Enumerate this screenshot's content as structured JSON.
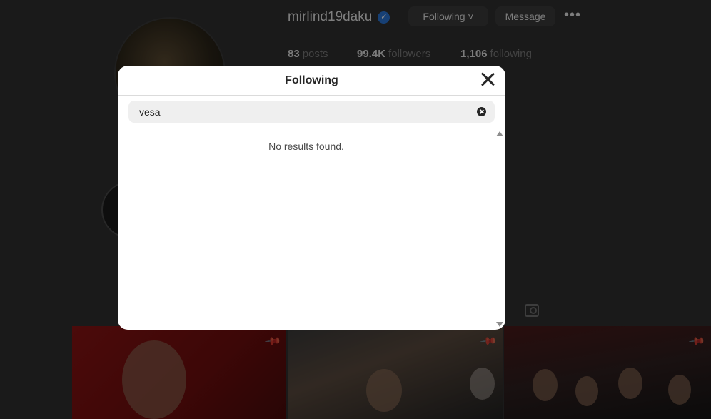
{
  "profile": {
    "username": "mirlind19daku",
    "verified_icon": "verified-badge-icon",
    "following_button": "Following",
    "following_chevron": "˅",
    "message_button": "Message",
    "more_icon": "•••",
    "stats": {
      "posts_count": "83",
      "posts_label": "posts",
      "followers_count": "99.4K",
      "followers_label": "followers",
      "following_count": "1,106",
      "following_label": "following"
    }
  },
  "modal": {
    "title": "Following",
    "search_value": "vesa",
    "no_results": "No results found."
  },
  "colors": {
    "modal_bg": "#ffffff",
    "search_bg": "#efefef",
    "backdrop": "#303030",
    "verified": "#2b76d6"
  }
}
